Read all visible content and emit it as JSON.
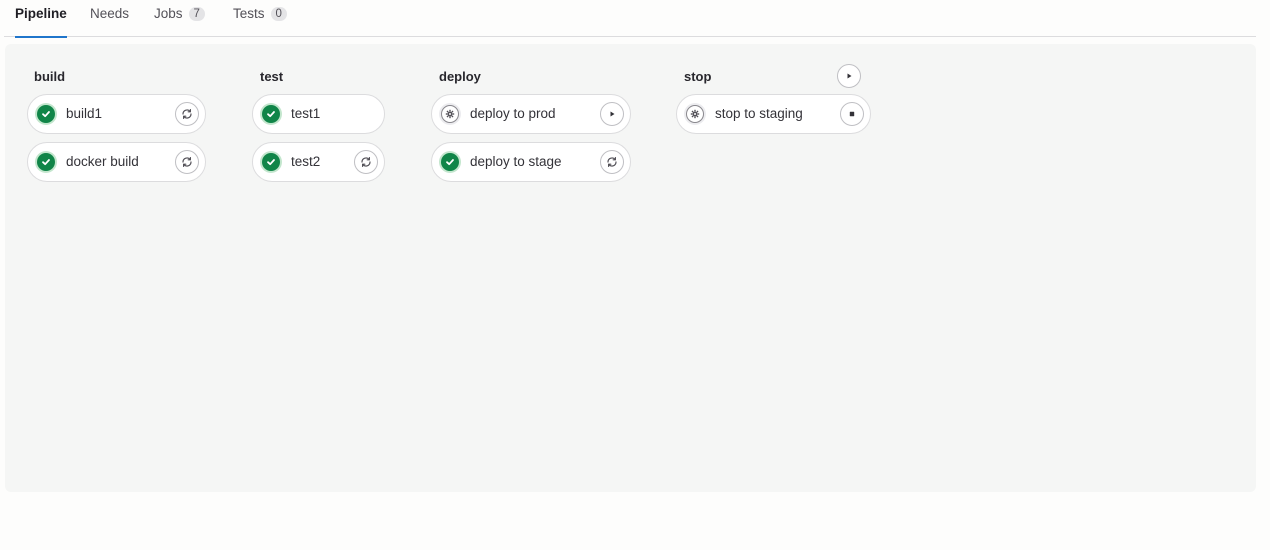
{
  "tabs": [
    {
      "label": "Pipeline",
      "active": true
    },
    {
      "label": "Needs"
    },
    {
      "label": "Jobs",
      "count": "7"
    },
    {
      "label": "Tests",
      "count": "0"
    }
  ],
  "stages": [
    {
      "name": "build",
      "jobs": [
        {
          "name": "build1",
          "status": "success",
          "action_icon": "retry-icon"
        },
        {
          "name": "docker build",
          "status": "success",
          "action_icon": "retry-icon"
        }
      ]
    },
    {
      "name": "test",
      "jobs": [
        {
          "name": "test1",
          "status": "success",
          "action_icon": null
        },
        {
          "name": "test2",
          "status": "success",
          "action_icon": "retry-icon"
        }
      ]
    },
    {
      "name": "deploy",
      "jobs": [
        {
          "name": "deploy to prod",
          "status": "manual",
          "action_icon": "play-icon"
        },
        {
          "name": "deploy to stage",
          "status": "success",
          "action_icon": "retry-icon"
        }
      ]
    },
    {
      "name": "stop",
      "stage_action_icon": "play-icon",
      "jobs": [
        {
          "name": "stop to staging",
          "status": "manual",
          "action_icon": "stop-icon"
        }
      ]
    }
  ],
  "colors": {
    "success": "#108548",
    "tab_underline": "#1f75cb",
    "panel_bg": "#f5f6f5"
  }
}
